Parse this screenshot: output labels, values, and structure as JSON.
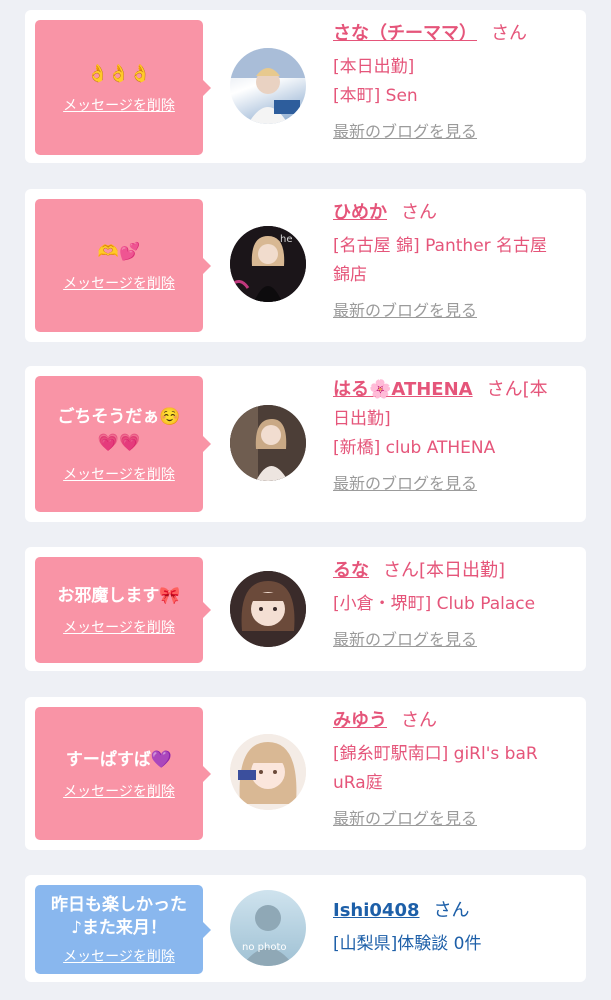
{
  "cards": [
    {
      "message": "👌👌👌",
      "delete_label": "メッセージを削除",
      "name": "さな（チーママ）",
      "suffix": "さん",
      "lines": [
        "[本日出勤]",
        "[本町] Sen"
      ],
      "blog_label": "最新のブログを見る"
    },
    {
      "message": "🫶💕",
      "delete_label": "メッセージを削除",
      "name": "ひめか",
      "suffix": "さん",
      "lines": [
        "[名古屋 錦] Panther 名古屋",
        "錦店"
      ],
      "blog_label": "最新のブログを見る"
    },
    {
      "message": "ごちそうだぁ☺️",
      "message2": "💗💗",
      "delete_label": "メッセージを削除",
      "name": "はる🌸ATHENA",
      "suffix": "さん[本",
      "lines": [
        "日出勤]",
        "[新橋] club ATHENA"
      ],
      "blog_label": "最新のブログを見る"
    },
    {
      "message": "お邪魔します🎀",
      "delete_label": "メッセージを削除",
      "name": "るな",
      "suffix": "さん[本日出勤]",
      "lines": [
        "[小倉・堺町] Club Palace"
      ],
      "blog_label": "最新のブログを見る"
    },
    {
      "message": "すーぱすば💜",
      "delete_label": "メッセージを削除",
      "name": "みゆう",
      "suffix": "さん",
      "lines": [
        "[錦糸町駅南口] giRl's baR",
        "uRa庭"
      ],
      "blog_label": "最新のブログを見る"
    },
    {
      "message": "昨日も楽しかった",
      "message2": "♪また来月！",
      "delete_label": "メッセージを削除",
      "name": "Ishi0408",
      "suffix": "さん",
      "lines": [
        "[山梨県]体験談 0件"
      ],
      "avatar_text": "no photo"
    }
  ],
  "colors": {
    "accent_pink": "#f994a6",
    "accent_blue": "#89b7ee",
    "name_pink": "#e5557a",
    "name_blue": "#1d5fa8"
  }
}
